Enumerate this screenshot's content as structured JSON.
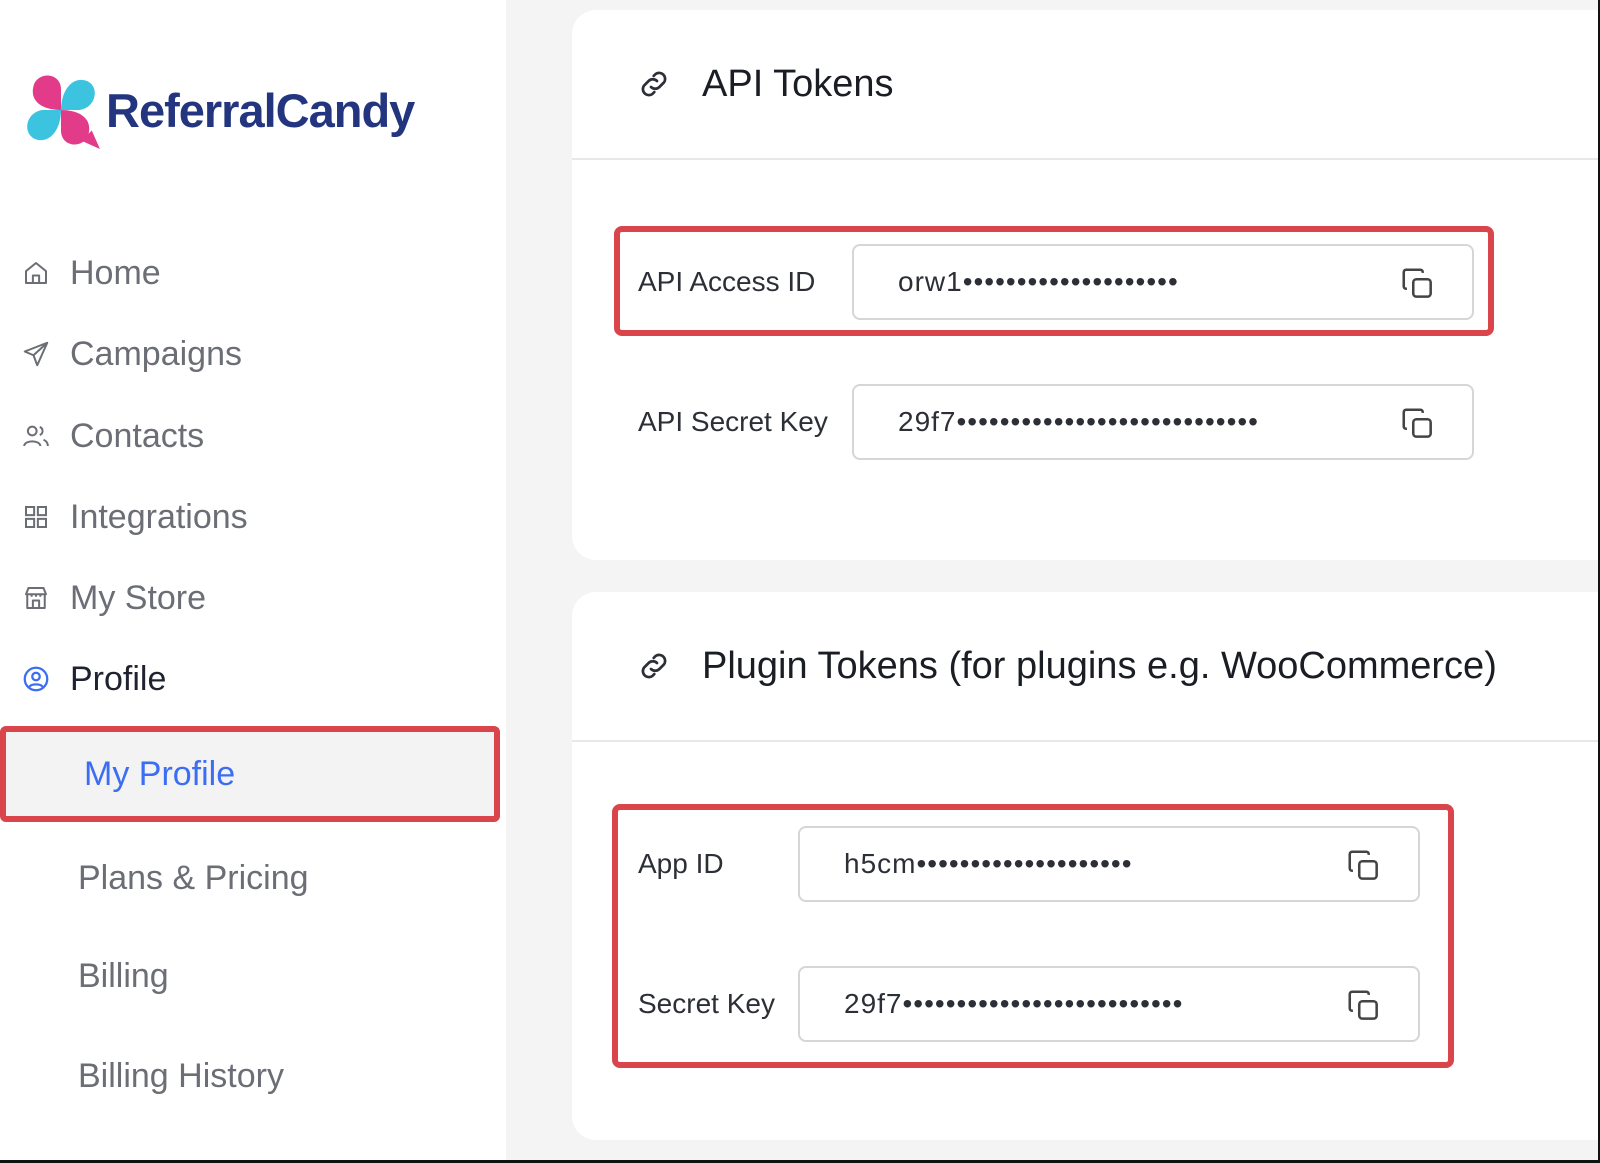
{
  "brand": {
    "name": "ReferralCandy"
  },
  "sidebar": {
    "items": [
      {
        "label": "Home",
        "icon": "home-icon"
      },
      {
        "label": "Campaigns",
        "icon": "send-icon"
      },
      {
        "label": "Contacts",
        "icon": "users-icon"
      },
      {
        "label": "Integrations",
        "icon": "grid-icon"
      },
      {
        "label": "My Store",
        "icon": "store-icon"
      },
      {
        "label": "Profile",
        "icon": "user-circle-icon",
        "active": true
      }
    ],
    "subitems": [
      {
        "label": "My Profile",
        "selected": true
      },
      {
        "label": "Plans & Pricing"
      },
      {
        "label": "Billing"
      },
      {
        "label": "Billing History"
      }
    ]
  },
  "api_tokens": {
    "title": "API Tokens",
    "fields": [
      {
        "label": "API Access ID",
        "value": "orw1••••••••••••••••••••"
      },
      {
        "label": "API Secret Key",
        "value": "29f7••••••••••••••••••••••••••••"
      }
    ]
  },
  "plugin_tokens": {
    "title": "Plugin Tokens (for plugins e.g. WooCommerce)",
    "fields": [
      {
        "label": "App ID",
        "value": "h5cm••••••••••••••••••••"
      },
      {
        "label": "Secret Key",
        "value": "29f7••••••••••••••••••••••••••"
      }
    ]
  },
  "colors": {
    "brand": "#24357f",
    "accent": "#3b6ef2",
    "highlight": "#d9454a",
    "logo_pink": "#e23b8a",
    "logo_cyan": "#3cc3e0"
  }
}
